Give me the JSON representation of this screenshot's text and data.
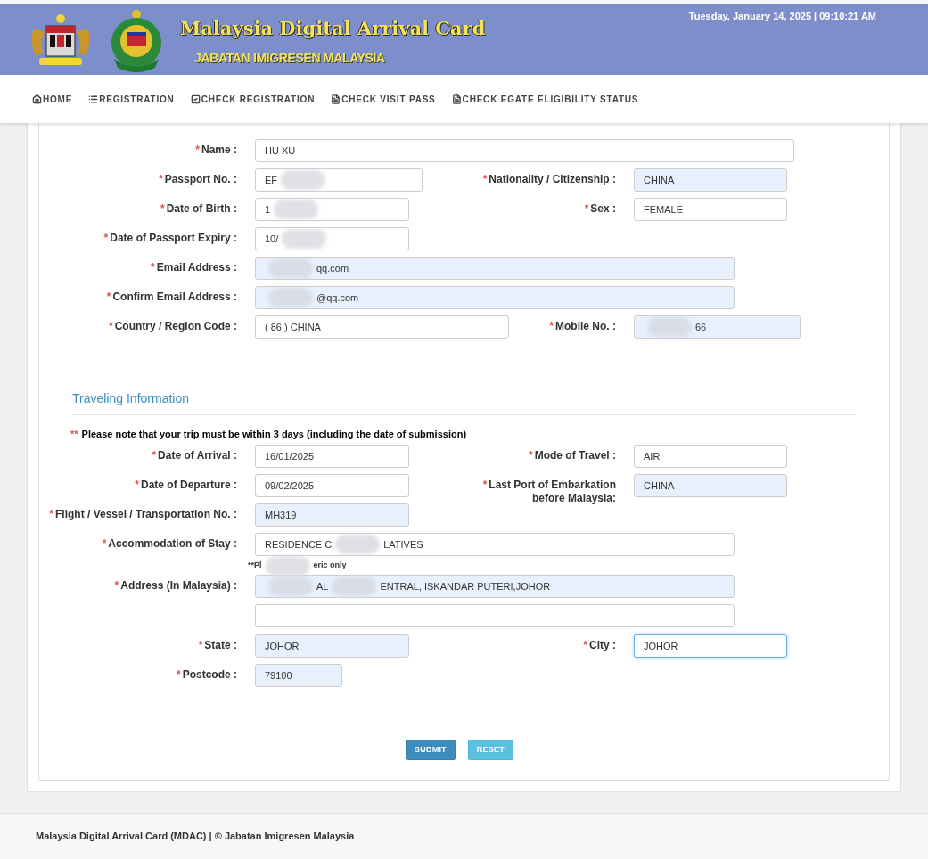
{
  "header": {
    "title": "Malaysia Digital Arrival Card",
    "subtitle": "JABATAN IMIGRESEN MALAYSIA",
    "datetime": "Tuesday, January 14, 2025 | 09:10:21 AM"
  },
  "nav": [
    {
      "kind": "home",
      "label": "HOME"
    },
    {
      "kind": "list",
      "label": "REGISTRATION"
    },
    {
      "kind": "check",
      "label": "CHECK REGISTRATION"
    },
    {
      "kind": "doc",
      "label": "CHECK VISIT PASS"
    },
    {
      "kind": "doc",
      "label": "CHECK EGATE ELIGIBILITY STATUS"
    }
  ],
  "personal_rows": [
    {
      "left": {
        "label": "Name :",
        "mark": "*",
        "autofilled": false,
        "focused": false,
        "parts": [
          {
            "kind": "text",
            "text": "HU XU"
          }
        ]
      }
    },
    {
      "left": {
        "label": "Passport No. :",
        "mark": "*",
        "autofilled": false,
        "focused": false,
        "parts": [
          {
            "kind": "text",
            "text": "EF"
          },
          {
            "kind": "redacted"
          }
        ]
      },
      "right": {
        "label": "Nationality / Citizenship :",
        "mark": "*",
        "autofilled": true,
        "focused": false,
        "parts": [
          {
            "kind": "text",
            "text": "CHINA"
          }
        ]
      }
    },
    {
      "left": {
        "label": "Date of Birth :",
        "mark": "*",
        "autofilled": false,
        "focused": false,
        "parts": [
          {
            "kind": "text",
            "text": "1"
          },
          {
            "kind": "redacted"
          }
        ]
      },
      "right": {
        "label": "Sex :",
        "mark": "*",
        "autofilled": false,
        "focused": false,
        "parts": [
          {
            "kind": "text",
            "text": "FEMALE"
          }
        ]
      }
    },
    {
      "left": {
        "label": "Date of Passport Expiry :",
        "mark": "*",
        "autofilled": false,
        "focused": false,
        "parts": [
          {
            "kind": "text",
            "text": "10/"
          },
          {
            "kind": "redacted"
          }
        ]
      }
    },
    {
      "left": {
        "label": "Email Address :",
        "mark": "*",
        "autofilled": true,
        "focused": false,
        "parts": [
          {
            "kind": "redacted"
          },
          {
            "kind": "text",
            "text": "qq.com"
          }
        ]
      }
    },
    {
      "left": {
        "label": "Confirm Email Address :",
        "mark": "*",
        "autofilled": true,
        "focused": false,
        "parts": [
          {
            "kind": "redacted"
          },
          {
            "kind": "text",
            "text": "@qq.com"
          }
        ]
      }
    },
    {
      "left": {
        "label": "Country / Region Code :",
        "mark": "*",
        "autofilled": false,
        "focused": false,
        "parts": [
          {
            "kind": "text",
            "text": "( 86 ) CHINA"
          }
        ]
      },
      "right": {
        "label": "Mobile No. :",
        "mark": "*",
        "autofilled": true,
        "focused": false,
        "parts": [
          {
            "kind": "redacted"
          },
          {
            "kind": "text",
            "text": "66"
          }
        ]
      }
    }
  ],
  "travel_section": {
    "title": "Traveling Information",
    "note_mark": "**",
    "note": "Please note that your trip must be within 3 days (including the date of submission)"
  },
  "travel_rows": [
    {
      "left": {
        "label": "Date of Arrival :",
        "mark": "*",
        "autofilled": false,
        "focused": false,
        "parts": [
          {
            "kind": "text",
            "text": "16/01/2025"
          }
        ]
      },
      "right": {
        "label": "Mode of Travel :",
        "mark": "*",
        "autofilled": false,
        "focused": false,
        "parts": [
          {
            "kind": "text",
            "text": "AIR"
          }
        ]
      }
    },
    {
      "left": {
        "label": "Date of Departure :",
        "mark": "*",
        "autofilled": false,
        "focused": false,
        "parts": [
          {
            "kind": "text",
            "text": "09/02/2025"
          }
        ]
      },
      "right": {
        "label": "Last Port of Embarkation before Malaysia:",
        "mark": "*",
        "autofilled": true,
        "focused": false,
        "parts": [
          {
            "kind": "text",
            "text": "CHINA"
          }
        ]
      }
    },
    {
      "left": {
        "label": "Flight / Vessel / Transportation No. :",
        "mark": "*",
        "autofilled": true,
        "focused": false,
        "parts": [
          {
            "kind": "text",
            "text": "MH319"
          }
        ]
      }
    },
    {
      "left": {
        "label": "Accommodation of Stay :",
        "mark": "*",
        "autofilled": false,
        "focused": false,
        "parts": [
          {
            "kind": "text",
            "text": "RESIDENCE C"
          },
          {
            "kind": "redacted"
          },
          {
            "kind": "text",
            "text": "LATIVES"
          }
        ]
      }
    }
  ],
  "address_hint": [
    {
      "kind": "text",
      "text": "**Pl"
    },
    {
      "kind": "redacted"
    },
    {
      "kind": "text",
      "text": "eric only"
    }
  ],
  "address": {
    "label": "Address (In Malaysia) :",
    "mark": "*",
    "lines": [
      {
        "autofilled": true,
        "focused": false,
        "parts": [
          {
            "kind": "redacted"
          },
          {
            "kind": "text",
            "text": "AL"
          },
          {
            "kind": "redacted"
          },
          {
            "kind": "text",
            "text": "ENTRAL, ISKANDAR PUTERI,JOHOR"
          }
        ]
      },
      {
        "autofilled": false,
        "focused": false
      }
    ]
  },
  "location_rows": [
    {
      "left": {
        "label": "State :",
        "mark": "*",
        "autofilled": true,
        "focused": false,
        "parts": [
          {
            "kind": "text",
            "text": "JOHOR"
          }
        ]
      },
      "right": {
        "label": "City :",
        "mark": "*",
        "autofilled": false,
        "focused": true,
        "parts": [
          {
            "kind": "text",
            "text": "JOHOR"
          }
        ]
      }
    },
    {
      "left": {
        "label": "Postcode :",
        "mark": "*",
        "autofilled": true,
        "focused": false,
        "parts": [
          {
            "kind": "text",
            "text": "79100"
          }
        ]
      }
    }
  ],
  "buttons": [
    {
      "kind": "primary",
      "label": "SUBMIT"
    },
    {
      "kind": "info",
      "label": "RESET"
    }
  ],
  "footer": "Malaysia Digital Arrival Card (MDAC) | © Jabatan Imigresen Malaysia"
}
